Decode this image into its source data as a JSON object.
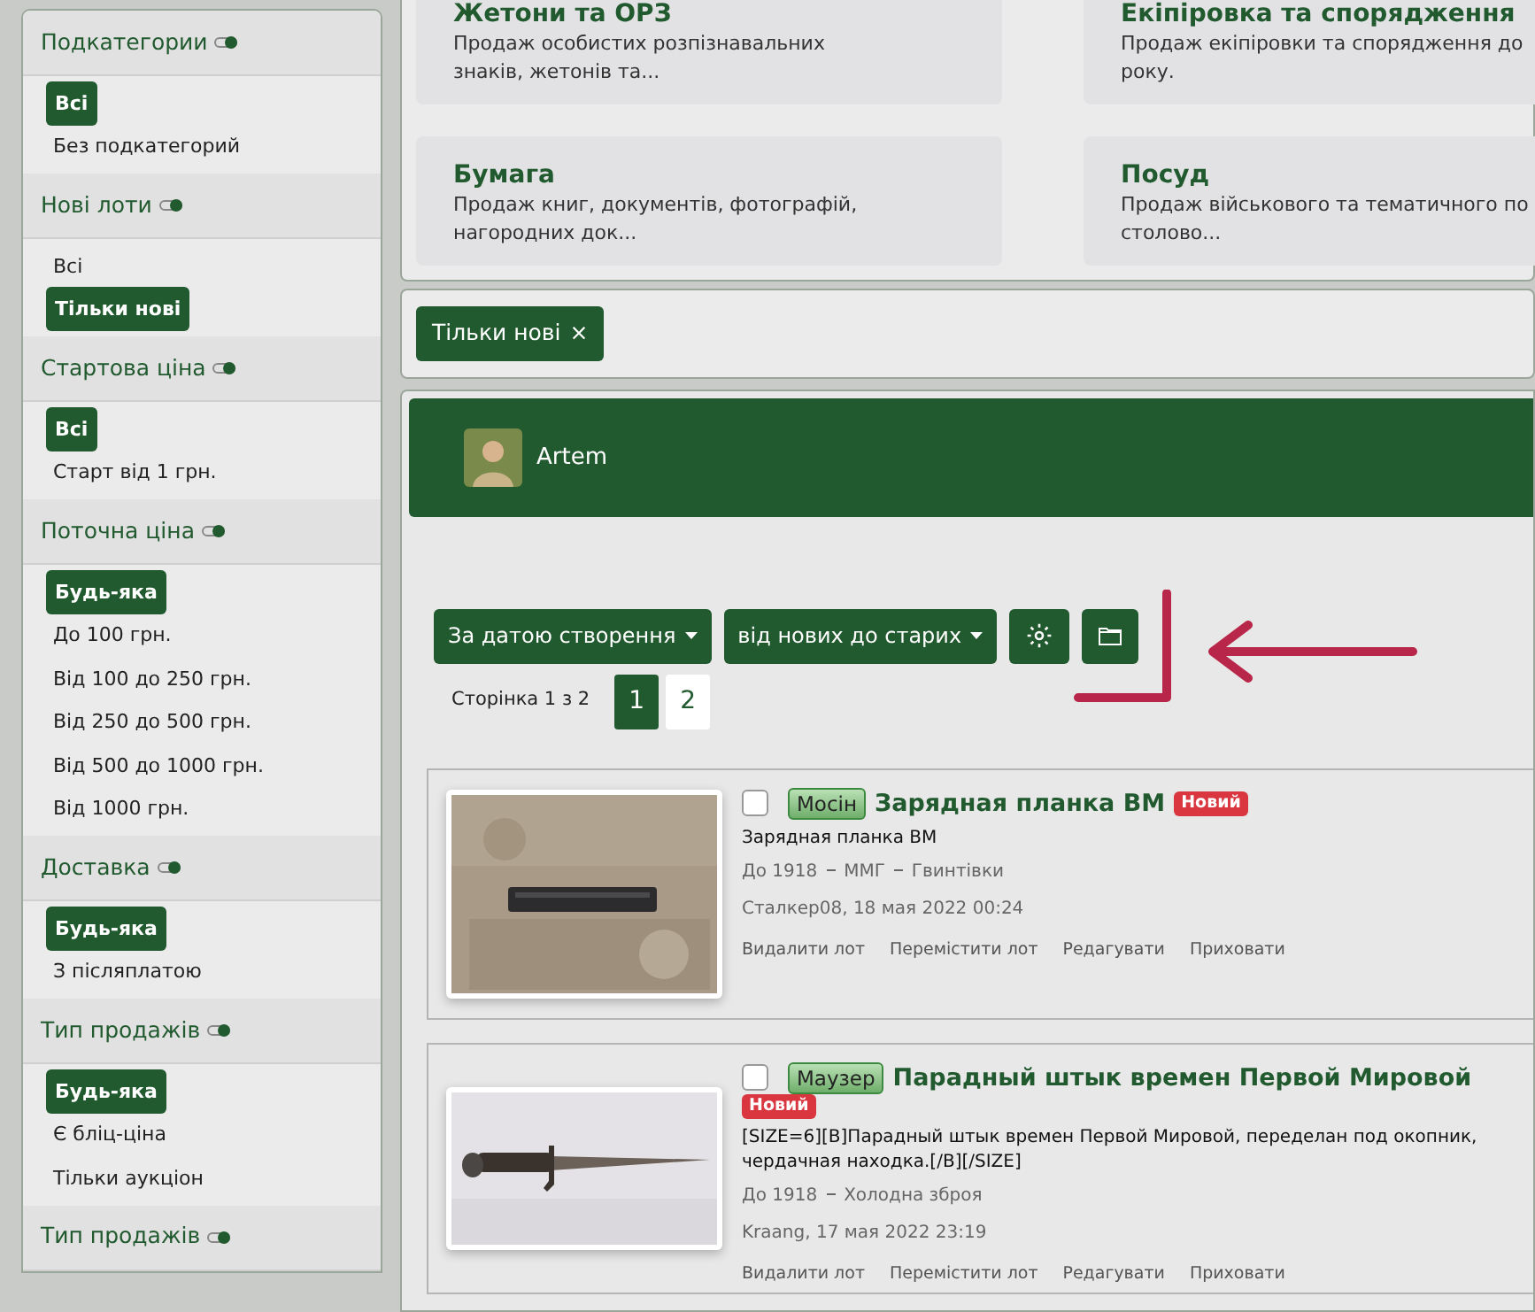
{
  "sidebar": {
    "groups": [
      {
        "title": "Подкатегории",
        "options": [
          {
            "label": "Всі",
            "selected": true
          },
          {
            "label": "Без подкатегорий",
            "selected": false
          }
        ]
      },
      {
        "title": "Нові лоти",
        "options": [
          {
            "label": "Всі",
            "selected": false
          },
          {
            "label": "Тільки нові",
            "selected": true
          }
        ]
      },
      {
        "title": "Стартова ціна",
        "options": [
          {
            "label": "Всі",
            "selected": true
          },
          {
            "label": "Старт від 1 грн.",
            "selected": false
          }
        ]
      },
      {
        "title": "Поточна ціна",
        "options": [
          {
            "label": "Будь-яка",
            "selected": true
          },
          {
            "label": "До 100 грн.",
            "selected": false
          },
          {
            "label": "Від 100 до 250 грн.",
            "selected": false
          },
          {
            "label": "Від 250 до 500 грн.",
            "selected": false
          },
          {
            "label": "Від 500 до 1000 грн.",
            "selected": false
          },
          {
            "label": "Від 1000 грн.",
            "selected": false
          }
        ]
      },
      {
        "title": "Доставка",
        "options": [
          {
            "label": "Будь-яка",
            "selected": true
          },
          {
            "label": "З післяплатою",
            "selected": false
          }
        ]
      },
      {
        "title": "Тип продажів",
        "options": [
          {
            "label": "Будь-яка",
            "selected": true
          },
          {
            "label": "Є бліц-ціна",
            "selected": false
          },
          {
            "label": "Тільки аукціон",
            "selected": false
          }
        ]
      },
      {
        "title": "Тип продажів"
      }
    ]
  },
  "categories": [
    {
      "title": "Жетони та ОРЗ",
      "description": "Продаж особистих розпізнавальних знаків, жетонів та..."
    },
    {
      "title": "Екіпіровка та спорядження",
      "description": "Продаж екіпіровки та спорядження до року."
    },
    {
      "title": "Бумага",
      "description": "Продаж книг, документів, фотографій, нагородних док..."
    },
    {
      "title": "Посуд",
      "description": "Продаж військового та тематичного по столово..."
    }
  ],
  "active_filters": [
    {
      "label": "Тільки нові",
      "remove": "×"
    }
  ],
  "user_header": {
    "name": "Artem"
  },
  "toolbar": {
    "sort_field": "За датою створення",
    "sort_order": "від нових до старих"
  },
  "pagination": {
    "label": "Сторінка 1 з 2",
    "pages": [
      {
        "label": "1",
        "selected": true
      },
      {
        "label": "2",
        "selected": false
      }
    ]
  },
  "lots": [
    {
      "checked": false,
      "prefix": "Мосін",
      "title": "Зарядная планка ВМ",
      "badge": "Новий",
      "description": "Зарядная планка ВМ",
      "breadcrumbs": [
        "До 1918",
        "ММГ",
        "Гвинтівки"
      ],
      "meta": "Сталкер08, 18 мая 2022 00:24",
      "actions": [
        "Видалити лот",
        "Перемістити лот",
        "Редагувати",
        "Приховати"
      ]
    },
    {
      "checked": false,
      "prefix": "Маузер",
      "title": "Парадный штык времен Первой Мировой",
      "badge": "Новий",
      "description": "[SIZE=6][B]Парадный штык времен Первой Мировой, переделан под окопник, чердачная находка.[/B][/SIZE]",
      "breadcrumbs": [
        "До 1918",
        "Холодна зброя"
      ],
      "meta": "Kraang, 17 мая 2022 23:19",
      "actions": [
        "Видалити лот",
        "Перемістити лот",
        "Редагувати",
        "Приховати"
      ]
    }
  ]
}
